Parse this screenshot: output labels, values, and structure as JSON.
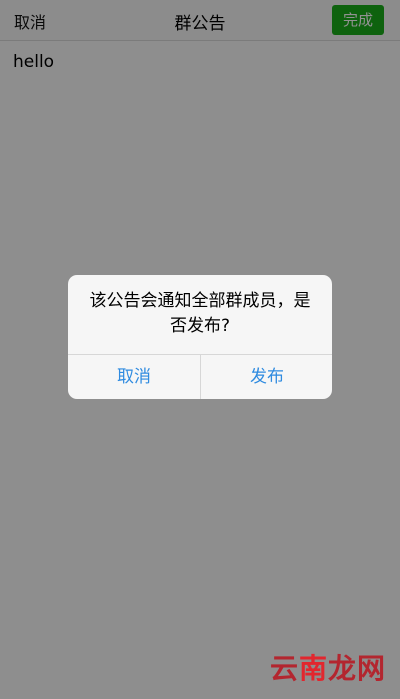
{
  "nav": {
    "cancel": "取消",
    "title": "群公告",
    "done": "完成"
  },
  "editor": {
    "text": "hello"
  },
  "alert": {
    "message": "该公告会通知全部群成员，是否发布?",
    "cancel": "取消",
    "confirm": "发布"
  },
  "watermark": {
    "part1": "云",
    "part2": "南",
    "part3": "龙网"
  },
  "colors": {
    "done_button": "#1aad19",
    "alert_button_text": "#2f8be0"
  }
}
